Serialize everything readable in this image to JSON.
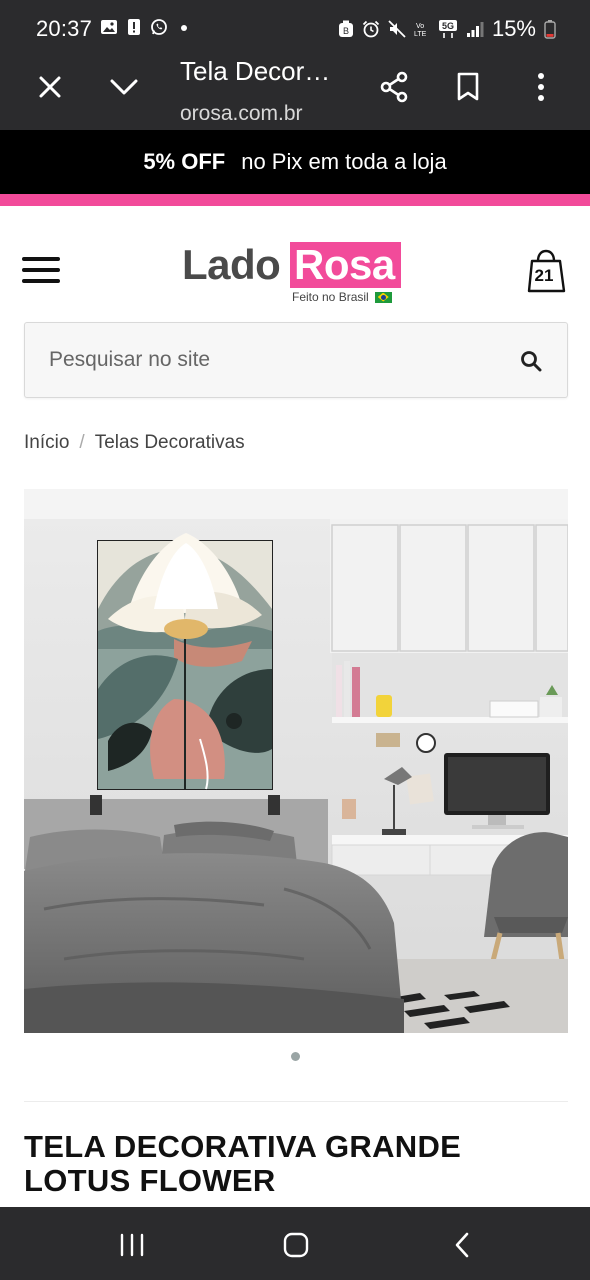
{
  "status_bar": {
    "time": "20:37",
    "battery": "15%",
    "network": "5G"
  },
  "browser": {
    "title": "Tela Decor…",
    "url": "orosa.com.br"
  },
  "promo": {
    "highlight": "5% OFF",
    "text": "no Pix em toda a loja",
    "accent_color": "#f24b9a"
  },
  "header": {
    "logo_lado": "Lado",
    "logo_rosa": "Rosa",
    "logo_tagline": "Feito no Brasil",
    "cart_count": "21"
  },
  "search": {
    "placeholder": "Pesquisar no site"
  },
  "breadcrumb": {
    "home": "Início",
    "separator": "/",
    "category": "Telas Decorativas"
  },
  "product": {
    "title": "TELA DECORATIVA GRANDE LOTUS FLOWER",
    "image_alt": "Tela decorativa lotus flower em quarto",
    "carousel_index": 1,
    "carousel_total": 1
  }
}
